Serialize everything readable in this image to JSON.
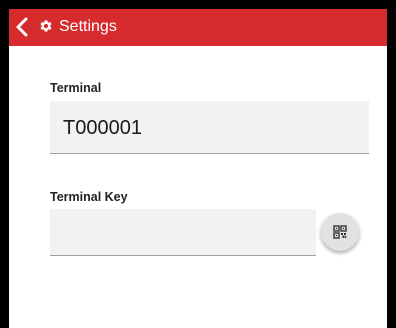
{
  "header": {
    "back_icon": "chevron-left-icon",
    "settings_icon": "gear-icon",
    "title": "Settings",
    "background_color": "#d62b2d"
  },
  "form": {
    "terminal": {
      "label": "Terminal",
      "value": "T000001"
    },
    "terminal_key": {
      "label": "Terminal Key",
      "value": "",
      "scan_button_icon": "qr-code-icon"
    }
  }
}
